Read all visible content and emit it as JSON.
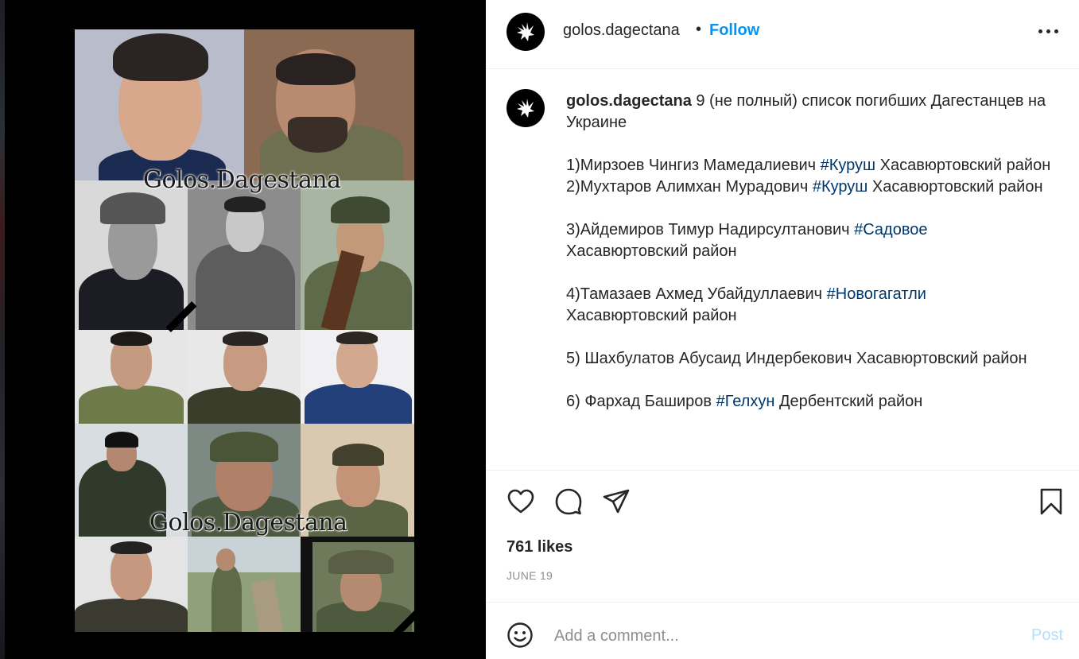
{
  "post": {
    "header": {
      "username": "golos.dagectana",
      "separator": "•",
      "follow_label": "Follow",
      "more_icon": "more-horizontal-icon"
    },
    "media": {
      "watermark_top": "Golos.Dagestana",
      "watermark_bottom": "Golos.Dagestana"
    },
    "caption": {
      "username": "golos.dagectana",
      "intro": " 9 (не полный) список погибших Дагестанцев на Украине",
      "entries": [
        {
          "pre": "1)Мирзоев Чингиз Мамедалиевич ",
          "tag": "#Куруш",
          "post": " Хасавюртовский район"
        },
        {
          "pre": "2)Мухтаров Алимхан Мурадович ",
          "tag": "#Куруш",
          "post": " Хасавюртовский район"
        },
        {
          "pre": "3)Айдемиров Тимур Надирсултанович ",
          "tag": "#Садовое",
          "post": " Хасавюртовский район"
        },
        {
          "pre": "4)Тамазаев Ахмед Убайдуллаевич ",
          "tag": "#Новогагатли",
          "post": " Хасавюртовский район"
        },
        {
          "pre": "5) Шахбулатов Абусаид Индербекович Хасавюртовский район",
          "tag": "",
          "post": ""
        },
        {
          "pre": "6) Фархад Баширов ",
          "tag": "#Гелхун",
          "post": " Дербентский район"
        }
      ]
    },
    "actions": {
      "like_icon": "heart-icon",
      "comment_icon": "comment-bubble-icon",
      "share_icon": "paper-plane-icon",
      "save_icon": "bookmark-icon"
    },
    "likes": "761 likes",
    "date": "JUNE 19",
    "comment_box": {
      "emoji_icon": "smiley-icon",
      "placeholder": "Add a comment...",
      "post_label": "Post"
    },
    "colors": {
      "accent": "#0095f6",
      "hashtag": "#00376b",
      "post_disabled": "#b2dffc",
      "muted": "#8e8e8e"
    }
  }
}
